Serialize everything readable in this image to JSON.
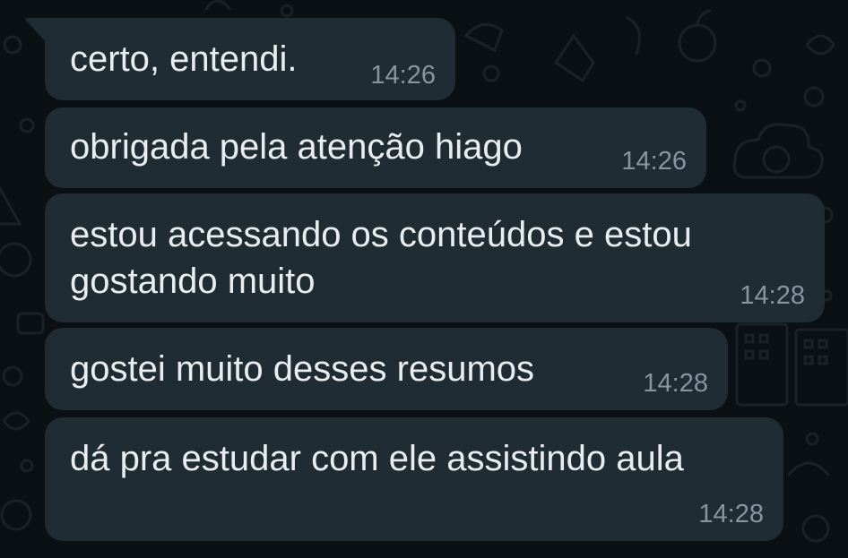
{
  "theme": {
    "background": "#0b1014",
    "bubble": "#1f2c33",
    "text": "#e9edef",
    "time": "#8696a0"
  },
  "messages": [
    {
      "text": "certo, entendi.",
      "time": "14:26"
    },
    {
      "text": "obrigada pela atenção hiago",
      "time": "14:26"
    },
    {
      "text": "estou acessando os conteúdos e estou gostando muito",
      "time": "14:28"
    },
    {
      "text": "gostei muito desses resumos",
      "time": "14:28"
    },
    {
      "text": "dá pra estudar com ele assistindo aula",
      "time": "14:28"
    }
  ]
}
